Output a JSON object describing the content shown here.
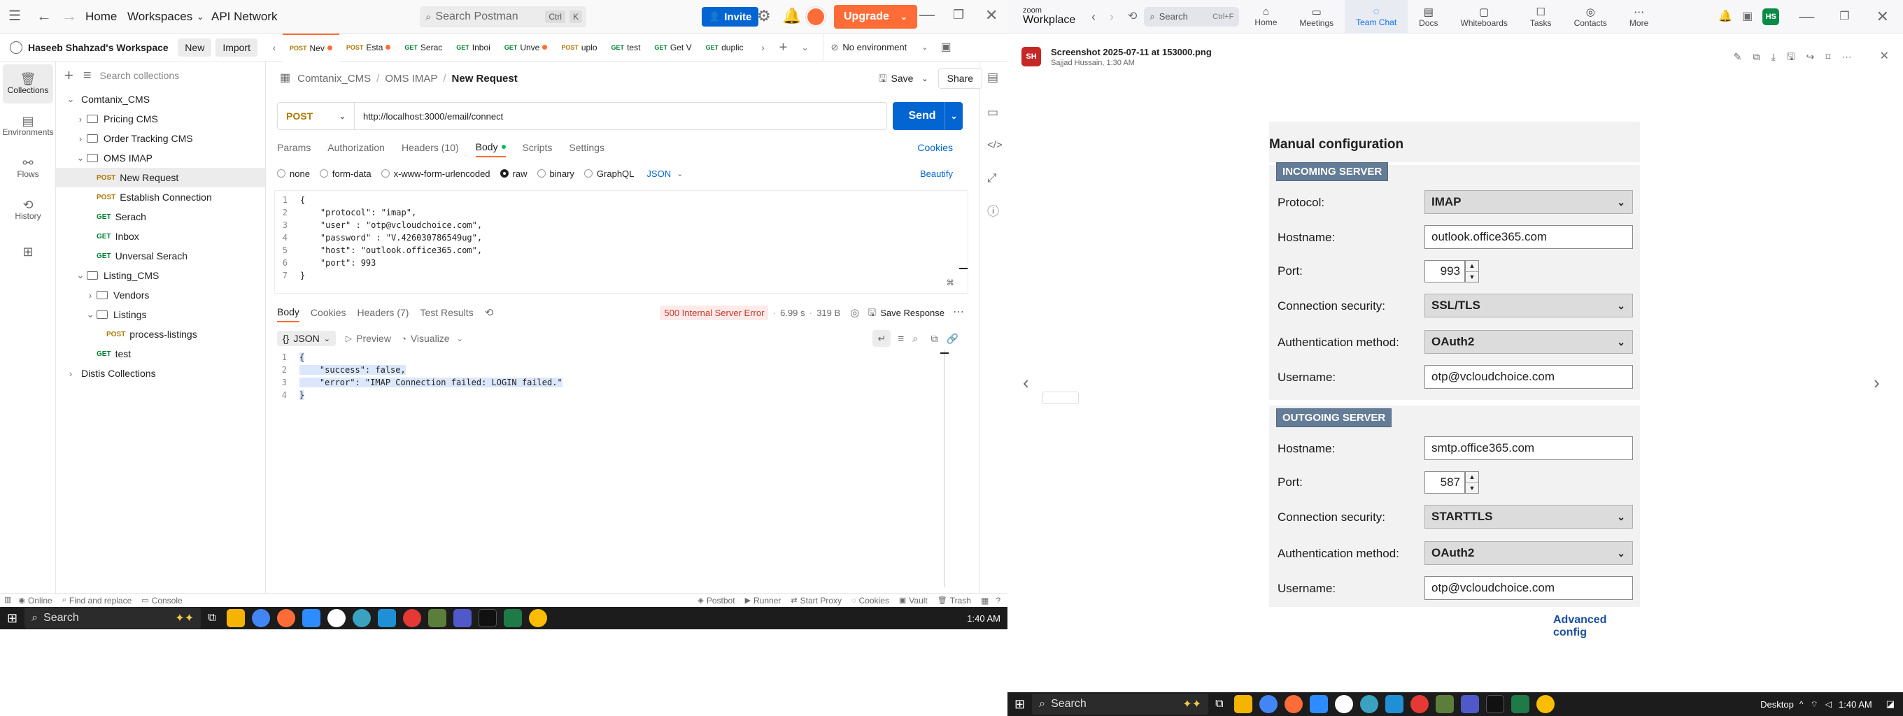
{
  "postman": {
    "topnav": {
      "home": "Home",
      "workspaces": "Workspaces",
      "api_network": "API Network"
    },
    "search": {
      "placeholder": "Search Postman",
      "shortcut_ctrl": "Ctrl",
      "shortcut_key": "K"
    },
    "invite": "Invite",
    "upgrade": "Upgrade",
    "workspace": {
      "name": "Haseeb Shahzad's Workspace",
      "new": "New",
      "import": "Import"
    },
    "rail": [
      {
        "label": "Collections",
        "icon": "collections-icon"
      },
      {
        "label": "Environments",
        "icon": "environments-icon"
      },
      {
        "label": "Flows",
        "icon": "flows-icon"
      },
      {
        "label": "History",
        "icon": "history-icon"
      },
      {
        "label": "",
        "icon": "configure-icon"
      }
    ],
    "tree_search_placeholder": "Search collections",
    "tree": [
      {
        "label": "Comtanix_CMS",
        "depth": 0,
        "type": "collection",
        "open": true
      },
      {
        "label": "Pricing CMS",
        "depth": 1,
        "type": "folder",
        "open": false
      },
      {
        "label": "Order Tracking CMS",
        "depth": 1,
        "type": "folder",
        "open": false
      },
      {
        "label": "OMS IMAP",
        "depth": 1,
        "type": "folder",
        "open": true
      },
      {
        "label": "New Request",
        "depth": 2,
        "type": "request",
        "method": "POST",
        "selected": true
      },
      {
        "label": "Establish Connection",
        "depth": 2,
        "type": "request",
        "method": "POST"
      },
      {
        "label": "Serach",
        "depth": 2,
        "type": "request",
        "method": "GET"
      },
      {
        "label": "Inbox",
        "depth": 2,
        "type": "request",
        "method": "GET"
      },
      {
        "label": "Unversal Serach",
        "depth": 2,
        "type": "request",
        "method": "GET"
      },
      {
        "label": "Listing_CMS",
        "depth": 1,
        "type": "folder",
        "open": true
      },
      {
        "label": "Vendors",
        "depth": 2,
        "type": "folder",
        "open": false
      },
      {
        "label": "Listings",
        "depth": 2,
        "type": "folder",
        "open": true
      },
      {
        "label": "process-listings",
        "depth": 3,
        "type": "request",
        "method": "POST"
      },
      {
        "label": "test",
        "depth": 2,
        "type": "request",
        "method": "GET"
      },
      {
        "label": "Distis Collections",
        "depth": 0,
        "type": "collection",
        "open": false
      }
    ],
    "tabs": [
      {
        "method": "POST",
        "label": "Nev",
        "dot": true,
        "active": true
      },
      {
        "method": "POST",
        "label": "Esta",
        "dot": true
      },
      {
        "method": "GET",
        "label": "Serac"
      },
      {
        "method": "GET",
        "label": "Inboi"
      },
      {
        "method": "GET",
        "label": "Unve",
        "dot": true
      },
      {
        "method": "POST",
        "label": "uplo"
      },
      {
        "method": "GET",
        "label": "test"
      },
      {
        "method": "GET",
        "label": "Get V"
      },
      {
        "method": "GET",
        "label": "duplic"
      }
    ],
    "environment": "No environment",
    "breadcrumb": [
      "Comtanix_CMS",
      "OMS IMAP",
      "New Request"
    ],
    "save": "Save",
    "share": "Share",
    "method": "POST",
    "url": "http://localhost:3000/email/connect",
    "send": "Send",
    "request_tabs": [
      "Params",
      "Authorization",
      "Headers (10)",
      "Body",
      "Scripts",
      "Settings"
    ],
    "cookies": "Cookies",
    "body_types": [
      "none",
      "form-data",
      "x-www-form-urlencoded",
      "raw",
      "binary",
      "GraphQL"
    ],
    "body_format": "JSON",
    "beautify": "Beautify",
    "request_body": [
      "{",
      "    \"protocol\": \"imap\",",
      "    \"user\" : \"otp@vcloudchoice.com\",",
      "    \"password\" : \"V.426030786549ug\",",
      "    \"host\": \"outlook.office365.com\",",
      "    \"port\": 993",
      "}"
    ],
    "response_tabs": [
      "Body",
      "Cookies",
      "Headers (7)",
      "Test Results"
    ],
    "status": "500 Internal Server Error",
    "time": "6.99 s",
    "size": "319 B",
    "save_response": "Save Response",
    "response_format": "JSON",
    "preview": "Preview",
    "visualize": "Visualize",
    "response_body": [
      "{",
      "    \"success\": false,",
      "    \"error\": \"IMAP Connection failed: LOGIN failed.\"",
      "}"
    ],
    "statusbar": {
      "online": "Online",
      "find_replace": "Find and replace",
      "console": "Console",
      "postbot": "Postbot",
      "runner": "Runner",
      "start_proxy": "Start Proxy",
      "cookies": "Cookies",
      "vault": "Vault",
      "trash": "Trash"
    }
  },
  "taskbar_left": {
    "search": "Search",
    "time": "1:40 AM"
  },
  "taskbar_right": {
    "search": "Search",
    "desktop": "Desktop",
    "time": "1:40 AM"
  },
  "zoom": {
    "brand_top": "zoom",
    "brand": "Workplace",
    "search": "Search",
    "search_shortcut": "Ctrl+F",
    "nav": [
      "Home",
      "Meetings",
      "Team Chat",
      "Docs",
      "Whiteboards",
      "Tasks",
      "Contacts",
      "More"
    ],
    "profile_initials": "HS",
    "file_avatar": "SH",
    "file_title": "Screenshot 2025-07-11 at 153000.png",
    "file_meta": "Sajjad Hussain, 1:30 AM",
    "form": {
      "title": "Manual configuration",
      "incoming_header": "INCOMING SERVER",
      "outgoing_header": "OUTGOING SERVER",
      "protocol_label": "Protocol:",
      "protocol": "IMAP",
      "hostname_label": "Hostname:",
      "in_hostname": "outlook.office365.com",
      "port_label": "Port:",
      "in_port": "993",
      "security_label": "Connection security:",
      "in_security": "SSL/TLS",
      "auth_label": "Authentication method:",
      "in_auth": "OAuth2",
      "username_label": "Username:",
      "in_username": "otp@vcloudchoice.com",
      "out_hostname": "smtp.office365.com",
      "out_port": "587",
      "out_security": "STARTTLS",
      "out_auth": "OAuth2",
      "out_username": "otp@vcloudchoice.com",
      "advanced": "Advanced config"
    }
  },
  "colors": {
    "postman_orange": "#ff6c37",
    "postman_blue": "#0265d2",
    "zoom_blue": "#0e71eb",
    "section_header": "#647c96"
  }
}
